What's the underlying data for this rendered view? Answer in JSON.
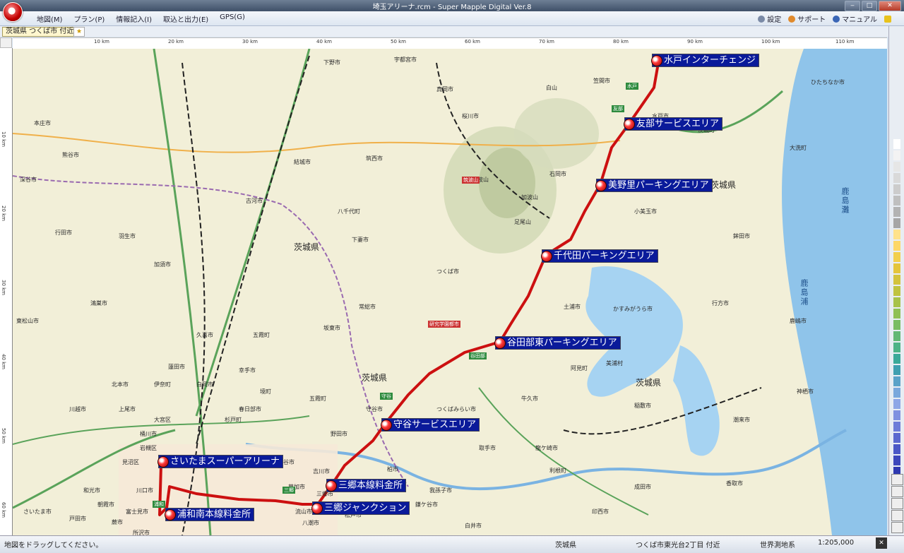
{
  "window": {
    "title": "埼玉アリーナ.rcm - Super Mapple Digital Ver.8",
    "controls": [
      "minimize",
      "maximize",
      "close"
    ]
  },
  "menubar": {
    "items": [
      "地図(M)",
      "プラン(P)",
      "情報記入(I)",
      "取込と出力(E)",
      "GPS(G)"
    ],
    "right": [
      {
        "label": "設定",
        "icon": "gear-icon"
      },
      {
        "label": "サポート",
        "icon": "support-icon"
      },
      {
        "label": "マニュアル",
        "icon": "help-icon"
      }
    ]
  },
  "location": {
    "tab_label": "茨城県 つくば市 付近",
    "pin_icon": "bookmark-icon"
  },
  "ruler": {
    "h_ticks": [
      "10 km",
      "20 km",
      "30 km",
      "40 km",
      "50 km",
      "60 km",
      "70 km",
      "80 km",
      "90 km",
      "100 km",
      "110 km"
    ],
    "v_ticks": [
      "10 km",
      "20 km",
      "30 km",
      "40 km",
      "50 km",
      "60 km"
    ]
  },
  "route": {
    "stops": [
      "水戸インターチェンジ",
      "友部サービスエリア",
      "美野里パーキングエリア",
      "千代田パーキングエリア",
      "谷田部東パーキングエリア",
      "守谷サービスエリア",
      "三郷本線料金所",
      "三郷ジャンクション",
      "浦和南本線料金所",
      "さいたまスーパーアリーナ"
    ],
    "color": "#cc1010",
    "label_bg": "#0a1a9a"
  },
  "map_labels": {
    "prefectures": [
      "茨城県",
      "茨城県",
      "茨城県",
      "茨城県"
    ],
    "seas": [
      "鹿島灘",
      "鹿島浦"
    ],
    "places": [
      "宇都宮市",
      "下野市",
      "真岡市",
      "笠間市",
      "桜川市",
      "筑西市",
      "結城市",
      "古河市",
      "八千代町",
      "下妻市",
      "常総市",
      "坂東市",
      "つくば市",
      "土浦市",
      "石岡市",
      "小美玉市",
      "鉾田市",
      "行方市",
      "かすみがうら市",
      "阿見町",
      "美浦村",
      "稲敷市",
      "牛久市",
      "龍ケ崎市",
      "取手市",
      "利根町",
      "守谷市",
      "つくばみらい市",
      "野田市",
      "柏市",
      "我孫子市",
      "吉川市",
      "草加市",
      "越谷市",
      "春日部市",
      "幸手市",
      "久喜市",
      "加須市",
      "羽生市",
      "行田市",
      "鴻巣市",
      "北本市",
      "上尾市",
      "川越市",
      "東松山市",
      "熊谷市",
      "深谷市",
      "本庄市",
      "蓮田市",
      "白岡市",
      "杉戸町",
      "五霞町",
      "境町",
      "五霞町",
      "水戸市",
      "ひたちなか市",
      "大洗町",
      "茨城町",
      "鹿嶋市",
      "神栖市",
      "潮来市",
      "香取市",
      "成田市",
      "印西市",
      "白井市",
      "鎌ケ谷市",
      "松戸市",
      "流山市",
      "三郷市",
      "八潮市",
      "所沢市",
      "富士見市",
      "朝霞市",
      "和光市",
      "戸田市",
      "蕨市",
      "川口市",
      "さいたま市",
      "桶川市",
      "伊奈町",
      "見沼区",
      "岩槻区",
      "大宮区",
      "白山",
      "筑波山",
      "足尾山",
      "加波山"
    ],
    "badges": [
      "筑波山",
      "研究学園都市",
      "水戸",
      "友部",
      "谷田部",
      "守谷",
      "三郷",
      "浦和"
    ]
  },
  "scale_strip": {
    "colors": [
      "#ffffff",
      "#f3f3f3",
      "#e6e6e6",
      "#d9d9d9",
      "#cccccc",
      "#bfbfbf",
      "#b3b3b3",
      "#a6a6a6",
      "#ffe28a",
      "#fdd766",
      "#f2cf4c",
      "#e4c53a",
      "#d3c33c",
      "#bfc340",
      "#a7c24a",
      "#8fc054",
      "#79bd63",
      "#62b874",
      "#4db387",
      "#3aa999",
      "#3f9fb0",
      "#5aa2c8",
      "#7aa8dc",
      "#8da6e6",
      "#7f91e0",
      "#6c7cd8",
      "#5b69cf",
      "#4a58c6",
      "#3b47bb",
      "#2e39b0"
    ],
    "buttons": [
      "grid-1-icon",
      "grid-2-icon",
      "grid-3-icon",
      "grid-4-icon",
      "grid-5-icon"
    ]
  },
  "statusbar": {
    "message": "地図をドラッグしてください。",
    "prefecture": "茨城県",
    "address": "つくば市東光台2丁目 付近",
    "datum": "世界測地系",
    "scale": "1:205,000"
  }
}
